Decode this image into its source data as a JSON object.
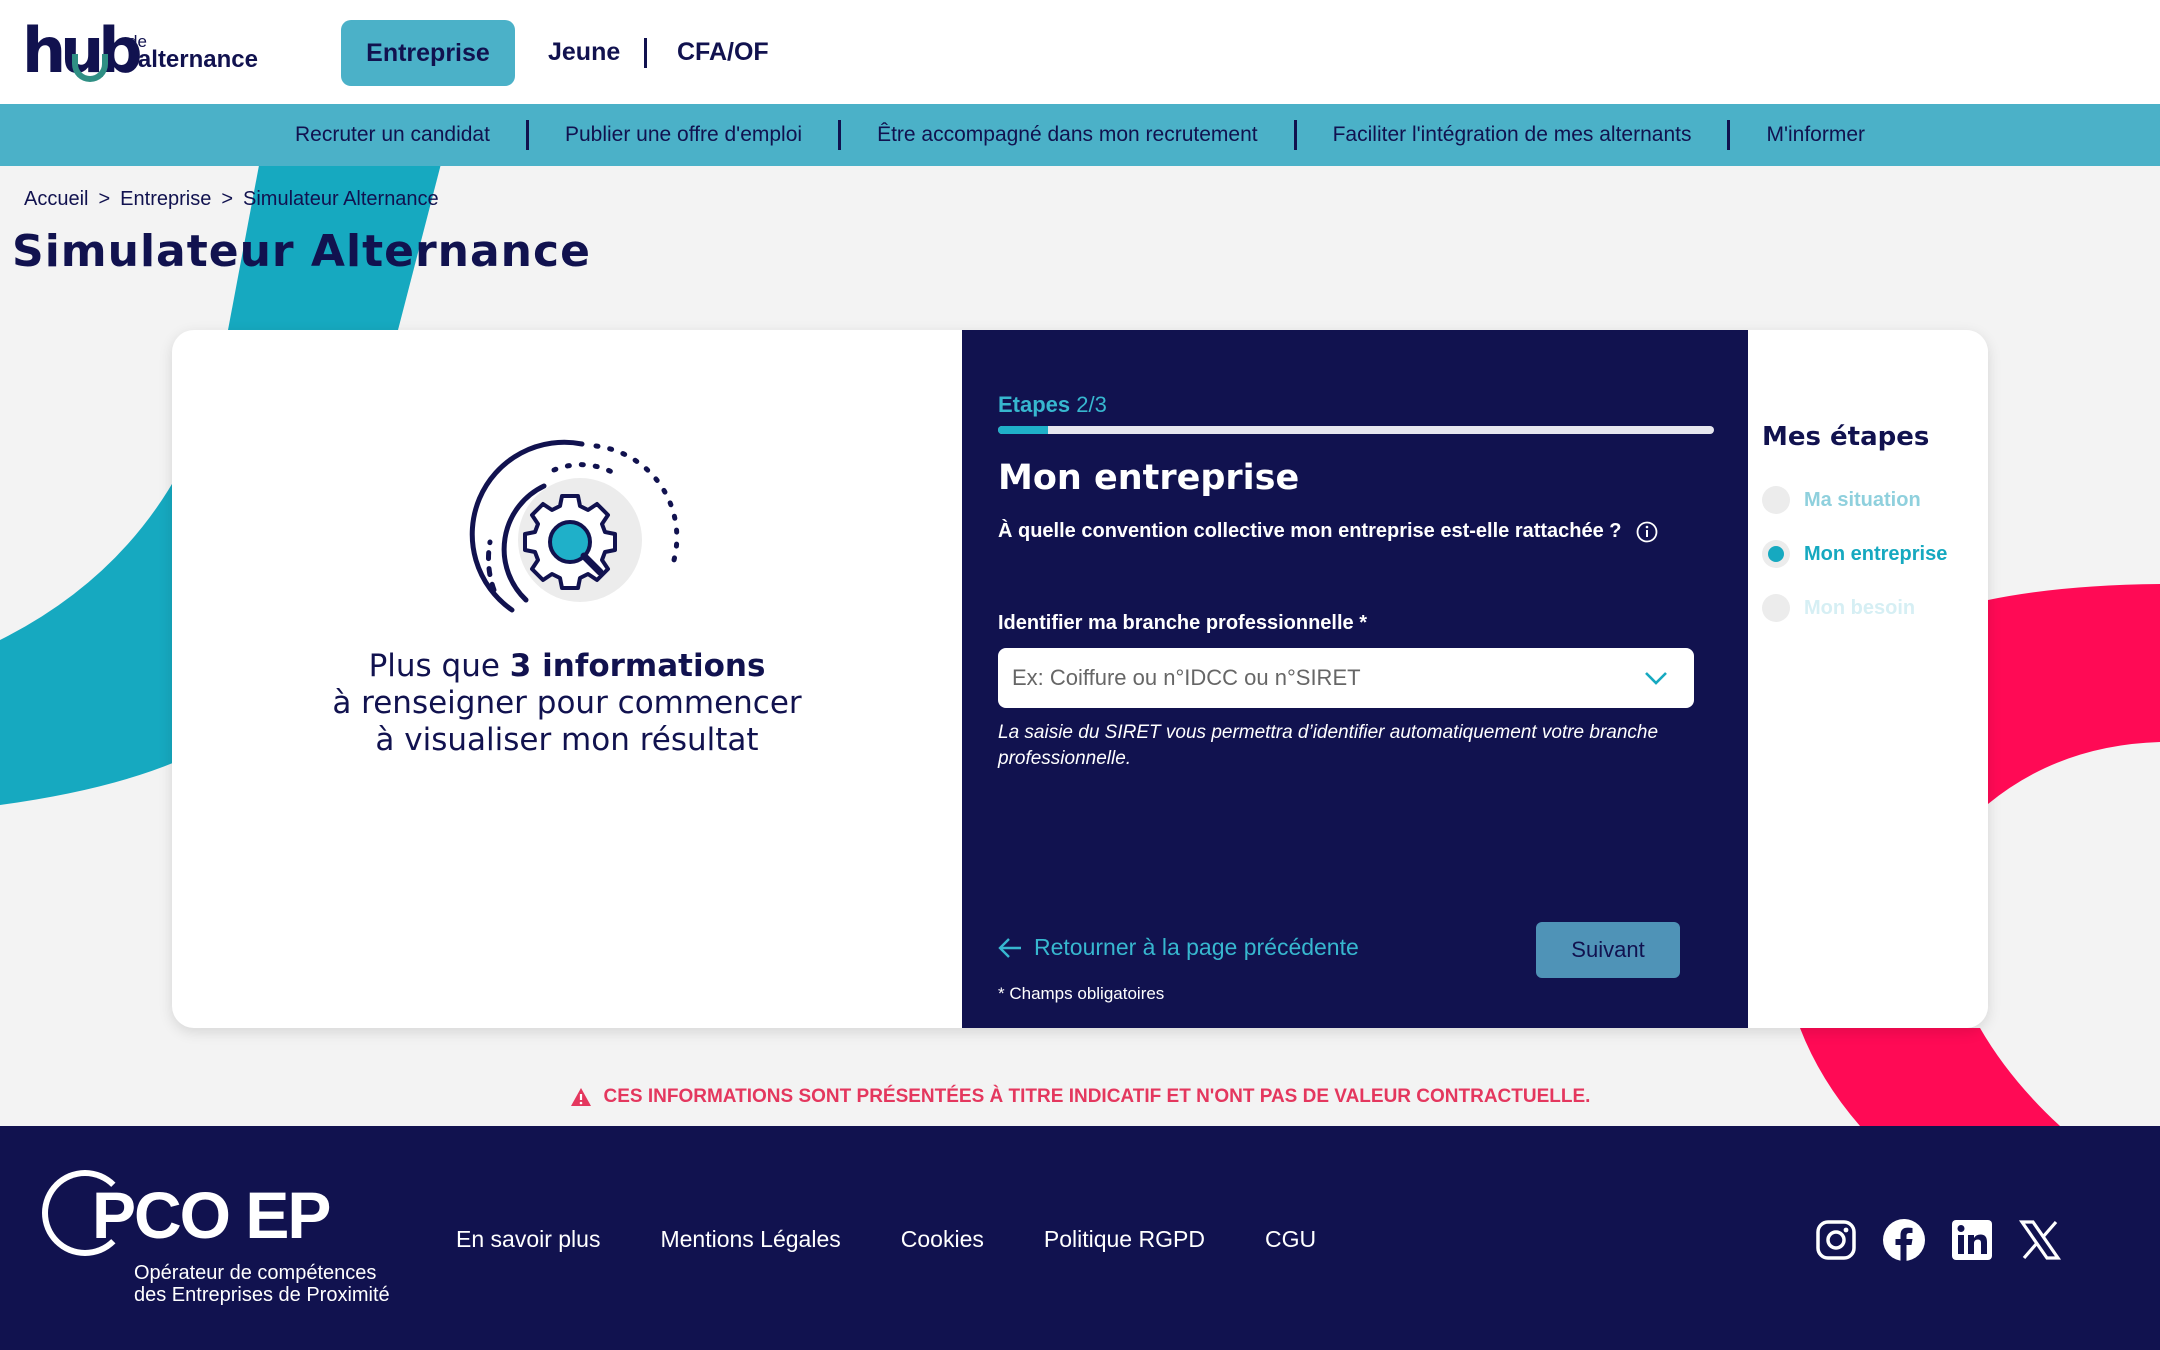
{
  "header": {
    "logo": {
      "hub": "hub",
      "de": "de",
      "alternance_prefix": "l'",
      "alternance": "alternance"
    },
    "tabs": [
      "Entreprise",
      "Jeune",
      "CFA/OF"
    ],
    "brand": "PCO EP"
  },
  "subnav": {
    "items": [
      "Recruter un candidat",
      "Publier une offre d'emploi",
      "Être accompagné dans mon recrutement",
      "Faciliter l'intégration de mes alternants",
      "M'informer"
    ]
  },
  "breadcrumb": {
    "items": [
      "Accueil",
      "Entreprise",
      "Simulateur Alternance"
    ],
    "separator": ">"
  },
  "page": {
    "title": "Simulateur Alternance"
  },
  "left": {
    "text_prefix": "Plus que ",
    "text_bold": "3 informations",
    "text_line2": "à renseigner pour commencer",
    "text_line3": "à visualiser mon résultat"
  },
  "form": {
    "steps_label": "Etapes",
    "steps_value": "2/3",
    "progress": 0.07,
    "title": "Mon entreprise",
    "question": "À quelle convention collective mon entreprise est-elle rattachée ?",
    "field_label": "Identifier ma branche professionnelle *",
    "field_placeholder": "Ex: Coiffure ou n°IDCC ou n°SIRET",
    "hint": "La saisie du SIRET vous permettra d’identifier automatiquement votre branche professionnelle.",
    "back_label": "Retourner à la page précédente",
    "next_label": "Suivant",
    "required_note": "* Champs obligatoires"
  },
  "sidebar": {
    "title": "Mes étapes",
    "steps": [
      "Ma situation",
      "Mon entreprise",
      "Mon besoin"
    ],
    "active_index": 1
  },
  "disclaimer": "CES INFORMATIONS SONT PRÉSENTÉES À TITRE INDICATIF ET N'ONT PAS DE VALEUR CONTRACTUELLE.",
  "footer": {
    "logo": "PCO EP",
    "tagline_1": "Opérateur de compétences",
    "tagline_2": "des Entreprises de Proximité",
    "links": [
      "En savoir plus",
      "Mentions Légales",
      "Cookies",
      "Politique RGPD",
      "CGU"
    ],
    "socials": [
      "instagram-icon",
      "facebook-icon",
      "linkedin-icon",
      "x-icon"
    ]
  },
  "colors": {
    "navy": "#11124f",
    "teal": "#4bb1c8",
    "accent": "#16a9c0",
    "pink": "#ff0a55",
    "warning": "#e4375e"
  }
}
